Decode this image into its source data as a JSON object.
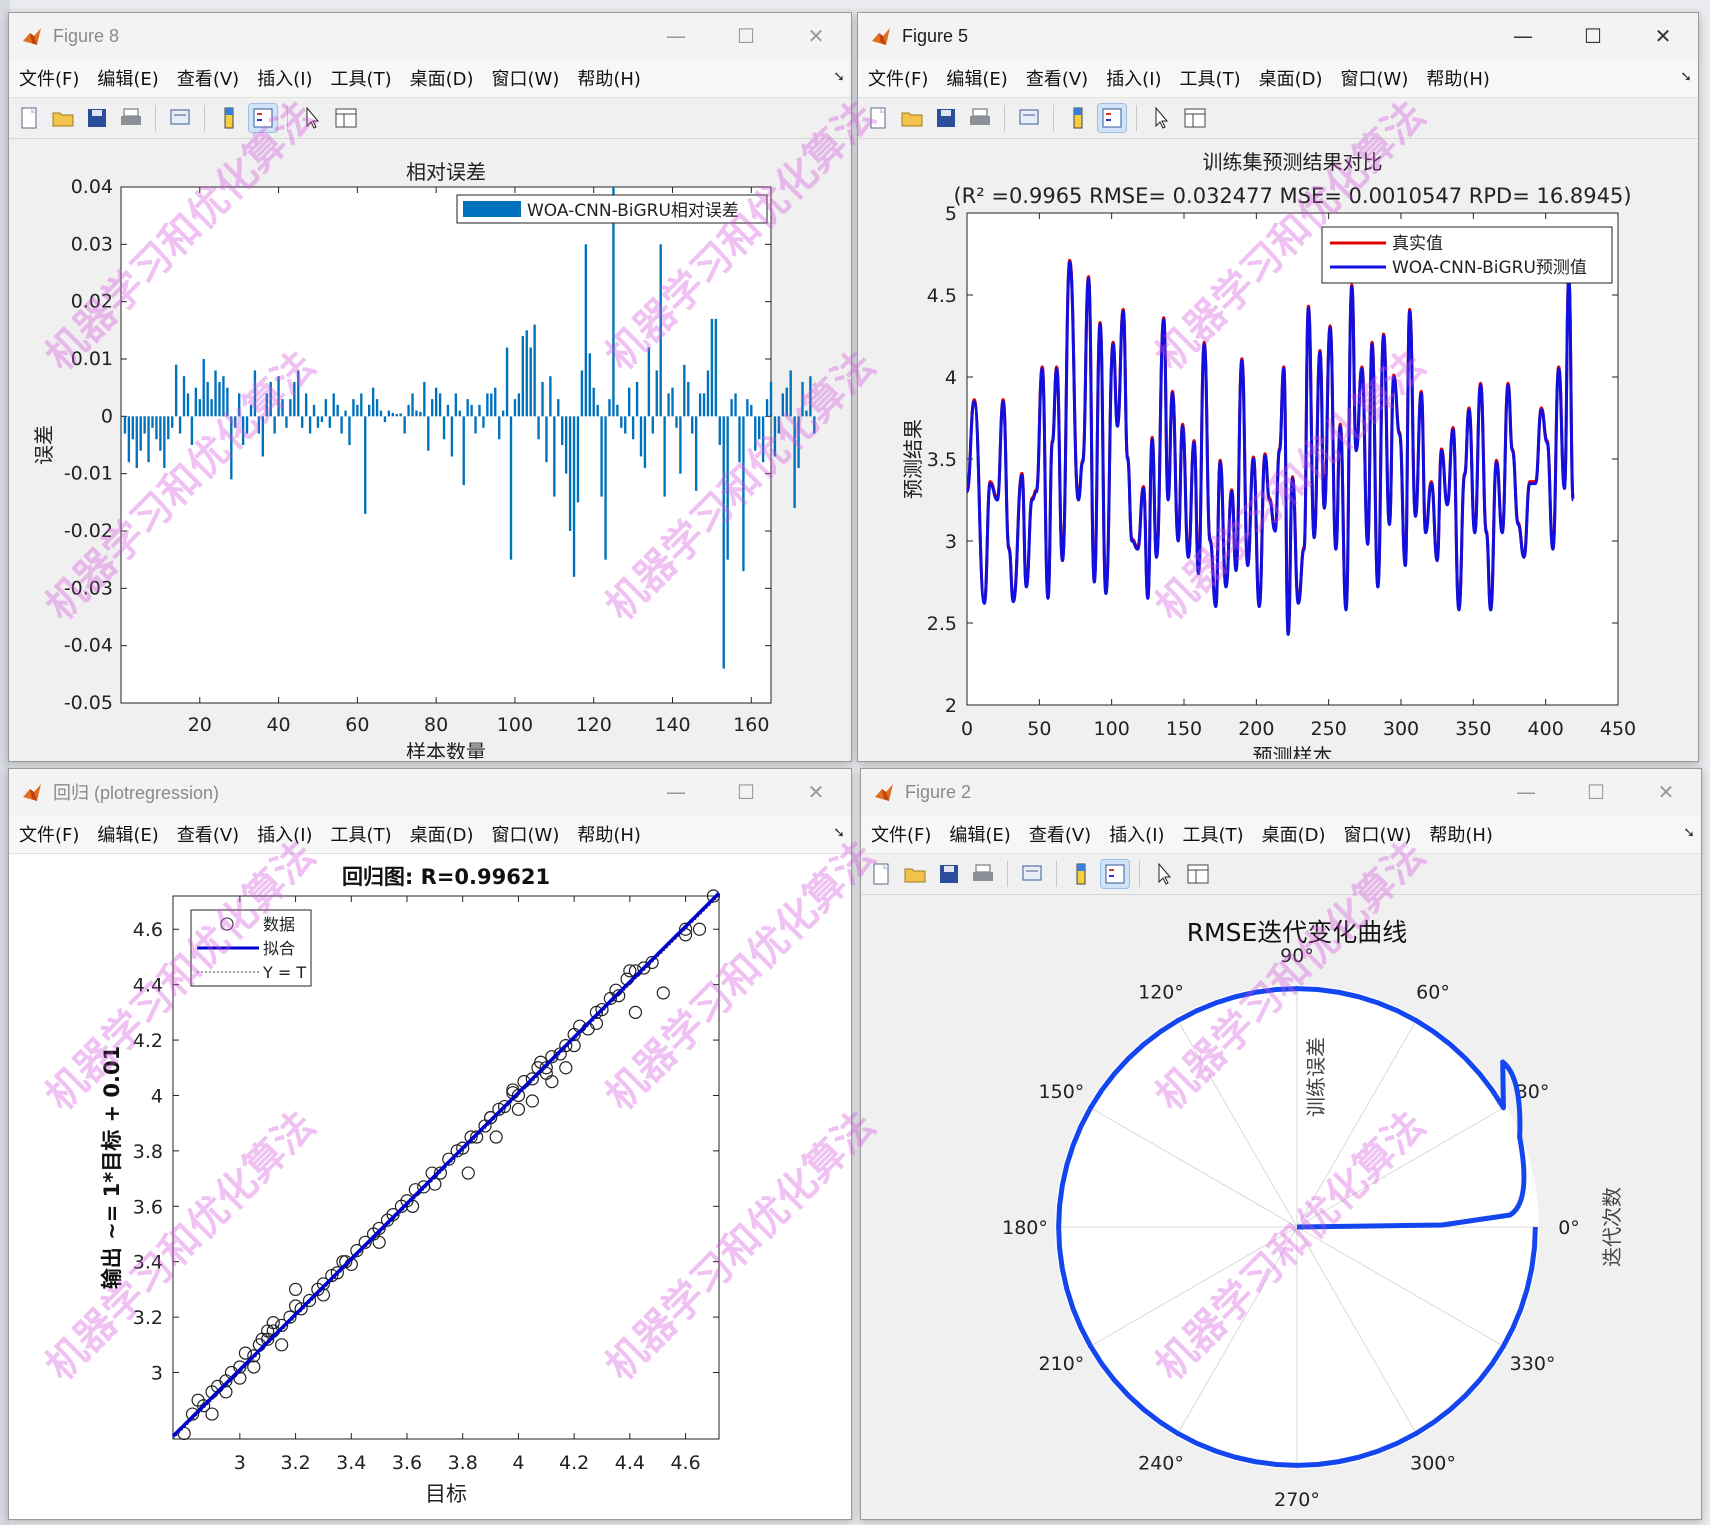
{
  "windows": {
    "fig8": {
      "title": "Figure 8",
      "menu": [
        "文件(F)",
        "编辑(E)",
        "查看(V)",
        "插入(I)",
        "工具(T)",
        "桌面(D)",
        "窗口(W)",
        "帮助(H)"
      ],
      "controls": {
        "min": "—",
        "max": "☐",
        "close": "✕"
      }
    },
    "fig5": {
      "title": "Figure 5",
      "menu": [
        "文件(F)",
        "编辑(E)",
        "查看(V)",
        "插入(I)",
        "工具(T)",
        "桌面(D)",
        "窗口(W)",
        "帮助(H)"
      ],
      "controls": {
        "min": "—",
        "max": "☐",
        "close": "✕"
      }
    },
    "reg": {
      "title": "回归 (plotregression)",
      "menu": [
        "文件(F)",
        "编辑(E)",
        "查看(V)",
        "插入(I)",
        "工具(T)",
        "桌面(D)",
        "窗口(W)",
        "帮助(H)"
      ],
      "controls": {
        "min": "—",
        "max": "☐",
        "close": "✕"
      }
    },
    "fig2": {
      "title": "Figure 2",
      "menu": [
        "文件(F)",
        "编辑(E)",
        "查看(V)",
        "插入(I)",
        "工具(T)",
        "桌面(D)",
        "窗口(W)",
        "帮助(H)"
      ],
      "controls": {
        "min": "—",
        "max": "☐",
        "close": "✕"
      }
    }
  },
  "toolbar_icons": [
    "new-file-icon",
    "open-folder-icon",
    "save-icon",
    "print-icon",
    "print-preview-icon",
    "colorbar-icon",
    "legend-icon",
    "pointer-icon",
    "property-inspector-icon"
  ],
  "watermark": "机器学习和优化算法",
  "chart_data": [
    {
      "id": "relative-error",
      "type": "bar",
      "title": "相对误差",
      "xlabel": "样本数量",
      "ylabel": "误差",
      "legend": [
        "WOA-CNN-BiGRU相对误差"
      ],
      "xlim": [
        0,
        165
      ],
      "ylim": [
        -0.05,
        0.04
      ],
      "xticks": [
        "20",
        "40",
        "60",
        "80",
        "100",
        "120",
        "140",
        "160"
      ],
      "yticks": [
        "0.04",
        "0.03",
        "0.02",
        "0.01",
        "0",
        "-0.01",
        "-0.02",
        "-0.03",
        "-0.04",
        "-0.05"
      ],
      "color": "#0072BD",
      "values": [
        -0.003,
        -0.008,
        -0.004,
        -0.009,
        -0.006,
        -0.003,
        -0.008,
        -0.002,
        -0.004,
        -0.006,
        -0.009,
        -0.004,
        -0.002,
        0.009,
        -0.003,
        0.007,
        0.004,
        -0.005,
        0.005,
        0.003,
        0.01,
        0.006,
        0.003,
        0.008,
        0.006,
        0.007,
        0.005,
        -0.011,
        -0.002,
        0.004,
        -0.005,
        -0.003,
        0.002,
        0.008,
        -0.003,
        -0.007,
        0.004,
        0.006,
        -0.003,
        0.007,
        0.003,
        -0.002,
        0.003,
        0.006,
        0.008,
        -0.002,
        0.004,
        -0.003,
        0.002,
        -0.002,
        -0.001,
        0.003,
        -0.002,
        0.004,
        0.002,
        -0.003,
        0.001,
        -0.005,
        0.003,
        0.002,
        0.004,
        -0.017,
        0.002,
        0.005,
        0.003,
        0.001,
        -0.001,
        0.001,
        0.0006,
        0.0004,
        0.0005,
        -0.003,
        0.002,
        0.004,
        0.001,
        0.0008,
        0.006,
        -0.006,
        0.003,
        0.005,
        0.004,
        -0.004,
        0.002,
        -0.007,
        0.004,
        0.001,
        -0.012,
        0.003,
        0.002,
        -0.003,
        0.002,
        -0.002,
        0.004,
        0.004,
        0.005,
        -0.004,
        0.001,
        0.012,
        -0.025,
        0.003,
        0.004,
        0.014,
        0.015,
        0.012,
        0.016,
        -0.004,
        0.006,
        -0.008,
        0.007,
        -0.014,
        0.003,
        -0.005,
        -0.01,
        -0.02,
        -0.028,
        -0.015,
        0.008,
        0.03,
        0.011,
        0.005,
        0.002,
        -0.014,
        -0.025,
        0.003,
        0.04,
        0.002,
        -0.002,
        -0.003,
        0.005,
        -0.004,
        0.006,
        -0.007,
        -0.009,
        0.012,
        -0.003,
        0.008,
        0.03,
        -0.014,
        0.004,
        0.005,
        -0.002,
        -0.01,
        0.009,
        0.006,
        -0.003,
        -0.013,
        0.004,
        0.004,
        0.008,
        0.017,
        0.017,
        -0.005,
        -0.044,
        -0.025,
        0.003,
        0.004,
        -0.008,
        -0.027,
        0.003,
        0.002,
        -0.006,
        -0.004,
        -0.008,
        0.003,
        0.006,
        -0.007,
        -0.003,
        0.004,
        0.005,
        0.008,
        -0.016,
        -0.009,
        0.006,
        0.001,
        0.007,
        -0.003
      ]
    },
    {
      "id": "train-prediction",
      "type": "line",
      "title": "训练集预测结果对比",
      "subtitle": "(R² =0.9965 RMSE= 0.032477 MSE= 0.0010547 RPD= 16.8945)",
      "xlabel": "预测样本",
      "ylabel": "预测结果",
      "xlim": [
        0,
        450
      ],
      "ylim": [
        2,
        5
      ],
      "xticks": [
        "0",
        "50",
        "100",
        "150",
        "200",
        "250",
        "300",
        "350",
        "400",
        "450"
      ],
      "yticks": [
        "5",
        "4.5",
        "4",
        "3.5",
        "3",
        "2.5",
        "2"
      ],
      "legend_position": "top-right",
      "series": [
        {
          "name": "真实值",
          "color": "#E00000"
        },
        {
          "name": "WOA-CNN-BiGRU预测值",
          "color": "#1010E0"
        }
      ],
      "keypoints_x": [
        0,
        5,
        12,
        16,
        21,
        25,
        29,
        32,
        38,
        41,
        45,
        48,
        52,
        56,
        59,
        62,
        66,
        71,
        77,
        80,
        84,
        88,
        92,
        96,
        101,
        104,
        108,
        111,
        114,
        118,
        122,
        125,
        128,
        131,
        136,
        139,
        142,
        146,
        149,
        153,
        157,
        160,
        164,
        168,
        172,
        175,
        179,
        183,
        186,
        190,
        194,
        198,
        202,
        206,
        209,
        213,
        216,
        219,
        222,
        225,
        229,
        233,
        236,
        240,
        244,
        247,
        251,
        255,
        258,
        262,
        266,
        269,
        273,
        277,
        280,
        284,
        288,
        292,
        295,
        299,
        303,
        306,
        310,
        314,
        317,
        321,
        325,
        328,
        332,
        336,
        340,
        344,
        347,
        351,
        355,
        359,
        362,
        366,
        370,
        374,
        377,
        381,
        385,
        389,
        393,
        397,
        401,
        405,
        409,
        413,
        416,
        419
      ],
      "keypoints_y": [
        3.3,
        3.85,
        2.62,
        3.35,
        3.25,
        3.85,
        2.95,
        2.63,
        3.4,
        2.72,
        3.25,
        3.3,
        4.05,
        2.65,
        3.6,
        4.05,
        2.88,
        4.7,
        3.25,
        3.48,
        4.6,
        2.75,
        4.32,
        2.68,
        4.2,
        3.7,
        4.4,
        3.5,
        3.0,
        2.95,
        3.32,
        2.65,
        3.62,
        2.9,
        4.35,
        3.25,
        3.9,
        3.0,
        3.7,
        2.9,
        3.6,
        2.8,
        4.2,
        3.0,
        2.6,
        3.48,
        2.72,
        3.3,
        2.82,
        4.1,
        2.85,
        3.5,
        2.6,
        3.52,
        3.25,
        3.06,
        3.55,
        4.05,
        2.43,
        3.38,
        2.62,
        2.95,
        4.42,
        3.02,
        4.15,
        3.2,
        4.3,
        2.95,
        3.7,
        2.58,
        4.55,
        3.55,
        4.05,
        2.98,
        4.2,
        2.72,
        4.25,
        3.1,
        4.0,
        3.65,
        2.85,
        4.4,
        3.15,
        3.9,
        3.05,
        3.35,
        2.88,
        3.55,
        3.22,
        3.68,
        2.58,
        3.4,
        3.8,
        3.05,
        3.95,
        3.05,
        2.58,
        3.48,
        3.05,
        3.95,
        3.55,
        3.1,
        2.9,
        3.35,
        3.35,
        3.8,
        3.6,
        2.95,
        4.05,
        3.32,
        4.6,
        3.25
      ]
    },
    {
      "id": "regression",
      "type": "scatter",
      "title": "回归图: R=0.99621",
      "xlabel": "目标",
      "ylabel": "输出 ~= 1*目标 + 0.01",
      "xlim": [
        2.76,
        4.72
      ],
      "ylim": [
        2.76,
        4.72
      ],
      "xticks": [
        "3",
        "3.2",
        "3.4",
        "3.6",
        "3.8",
        "4",
        "4.2",
        "4.4",
        "4.6"
      ],
      "yticks": [
        "4.6",
        "4.4",
        "4.2",
        "4",
        "3.8",
        "3.6",
        "3.4",
        "3.2",
        "3"
      ],
      "legend": [
        "数据",
        "拟合",
        "Y = T"
      ],
      "fit": {
        "slope": 1,
        "intercept": 0.01,
        "color": "#0000CC"
      },
      "points_x": [
        2.8,
        2.83,
        2.85,
        2.87,
        2.9,
        2.92,
        2.95,
        2.97,
        3.0,
        3.02,
        3.05,
        3.07,
        3.1,
        3.12,
        3.15,
        3.18,
        3.2,
        3.22,
        3.25,
        3.28,
        3.3,
        3.33,
        3.35,
        3.38,
        3.4,
        3.42,
        3.45,
        3.48,
        3.5,
        3.53,
        3.55,
        3.58,
        3.6,
        3.63,
        3.66,
        3.69,
        3.72,
        3.75,
        3.78,
        3.8,
        3.83,
        3.85,
        3.88,
        3.9,
        3.93,
        3.95,
        3.98,
        4.0,
        4.02,
        4.05,
        4.07,
        4.1,
        4.12,
        4.15,
        4.17,
        4.2,
        4.22,
        4.25,
        4.28,
        4.3,
        4.33,
        4.36,
        4.39,
        4.42,
        4.45,
        4.48,
        4.52,
        4.6,
        4.65,
        4.7,
        3.08,
        3.2,
        3.12,
        3.37,
        3.5,
        3.82,
        3.92,
        4.05,
        4.17,
        4.42,
        3.0,
        3.05,
        3.1,
        3.15,
        3.9,
        4.0,
        4.1,
        4.12,
        4.28,
        4.35,
        4.4,
        4.6,
        2.9,
        2.95,
        3.3,
        3.62,
        3.7,
        3.98,
        4.08,
        4.2
      ],
      "points_y": [
        2.78,
        2.85,
        2.9,
        2.88,
        2.93,
        2.95,
        2.97,
        3.0,
        3.02,
        3.07,
        3.06,
        3.1,
        3.12,
        3.15,
        3.17,
        3.2,
        3.24,
        3.23,
        3.26,
        3.3,
        3.32,
        3.35,
        3.36,
        3.4,
        3.39,
        3.44,
        3.47,
        3.5,
        3.52,
        3.55,
        3.57,
        3.6,
        3.62,
        3.66,
        3.67,
        3.72,
        3.72,
        3.77,
        3.8,
        3.81,
        3.85,
        3.85,
        3.89,
        3.92,
        3.95,
        3.96,
        4.01,
        4.0,
        4.05,
        4.06,
        4.1,
        4.1,
        4.14,
        4.15,
        4.18,
        4.22,
        4.25,
        4.24,
        4.3,
        4.31,
        4.35,
        4.36,
        4.42,
        4.45,
        4.46,
        4.48,
        4.37,
        4.6,
        4.6,
        4.72,
        3.12,
        3.3,
        3.18,
        3.4,
        3.47,
        3.72,
        3.85,
        3.98,
        4.1,
        4.3,
        2.98,
        3.02,
        3.15,
        3.1,
        3.92,
        3.95,
        4.08,
        4.05,
        4.26,
        4.38,
        4.45,
        4.58,
        2.85,
        2.93,
        3.28,
        3.6,
        3.68,
        4.02,
        4.12,
        4.18
      ]
    },
    {
      "id": "rmse-polar",
      "type": "polar",
      "title": "RMSE迭代变化曲线",
      "xlabel": "迭代次数",
      "ylabel": "训练误差",
      "angle_labels": [
        "0°",
        "30°",
        "60°",
        "90°",
        "120°",
        "150°",
        "180°",
        "210°",
        "240°",
        "270°",
        "300°",
        "330°"
      ],
      "color": "#1446F0"
    }
  ]
}
